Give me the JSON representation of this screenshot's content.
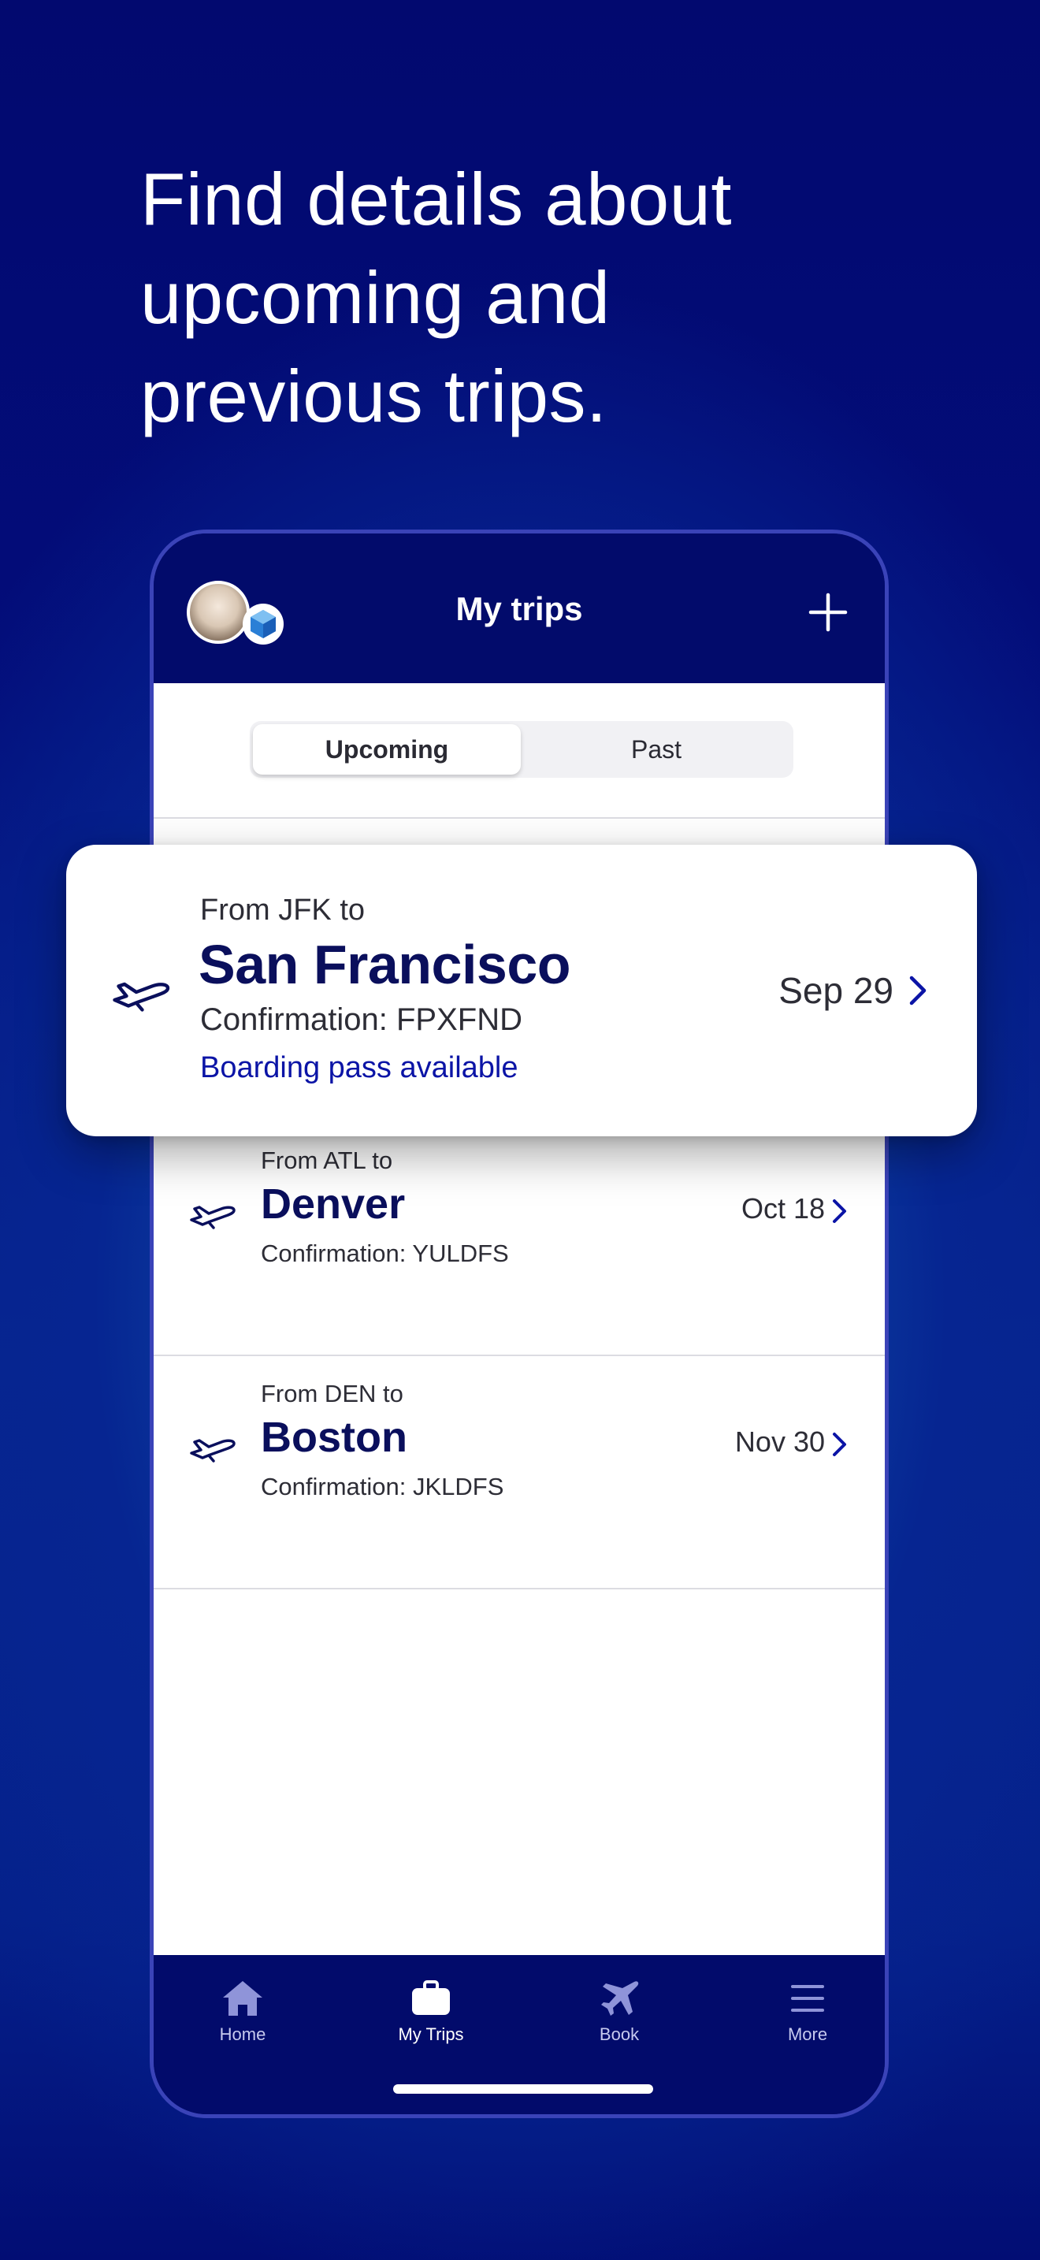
{
  "headline": {
    "line1": "Find details about",
    "line2": "upcoming and",
    "line3": "previous trips."
  },
  "header": {
    "title": "My trips",
    "add_icon": "plus-icon"
  },
  "segments": {
    "upcoming": "Upcoming",
    "past": "Past",
    "selected": "Upcoming"
  },
  "featured_trip": {
    "from": "From JFK to",
    "city": "San Francisco",
    "confirmation": "Confirmation: FPXFND",
    "status": "Boarding pass available",
    "date": "Sep 29"
  },
  "trips": [
    {
      "from": "From ATL to",
      "city": "Denver",
      "confirmation": "Confirmation: YULDFS",
      "date": "Oct 18"
    },
    {
      "from": "From DEN to",
      "city": "Boston",
      "confirmation": "Confirmation: JKLDFS",
      "date": "Nov 30"
    }
  ],
  "tabbar": {
    "home": "Home",
    "my_trips": "My Trips",
    "book": "Book",
    "more": "More",
    "active": "My Trips"
  },
  "colors": {
    "brand_navy": "#020b6b",
    "city_text": "#0a0f5c",
    "boarding_link": "#0b14a6"
  }
}
